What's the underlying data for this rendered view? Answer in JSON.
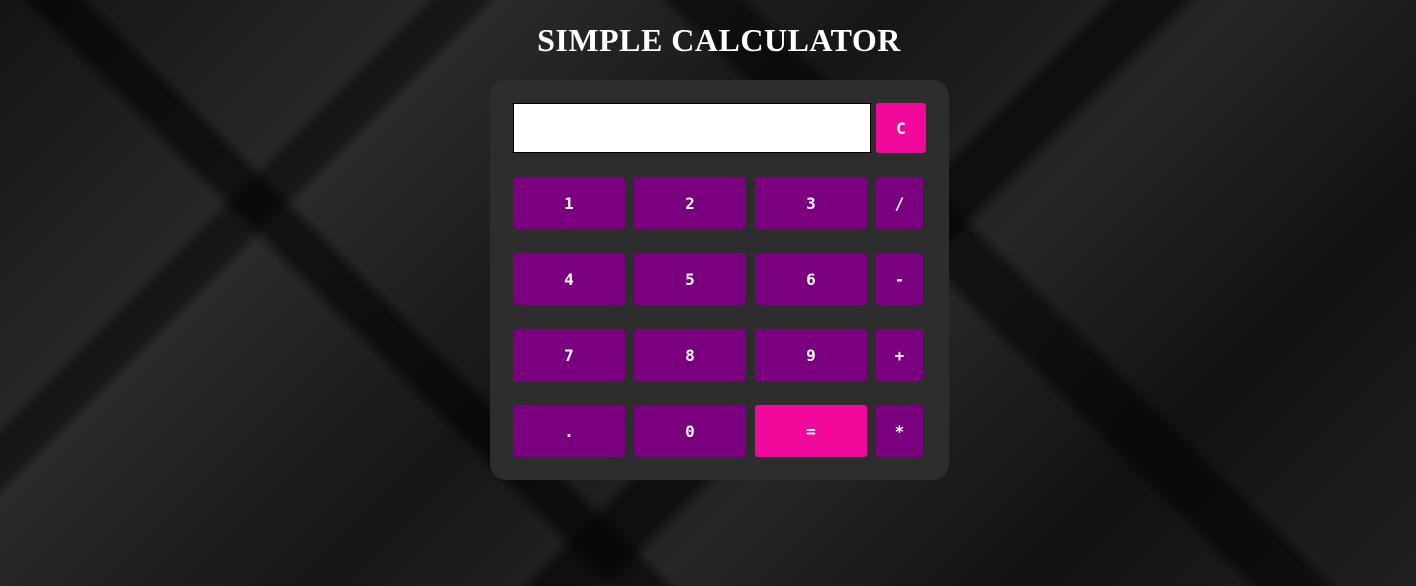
{
  "page": {
    "title": "SIMPLE CALCULATOR"
  },
  "display": {
    "value": ""
  },
  "buttons": {
    "clear": "C",
    "one": "1",
    "two": "2",
    "three": "3",
    "divide": "/",
    "four": "4",
    "five": "5",
    "six": "6",
    "subtract": "-",
    "seven": "7",
    "eight": "8",
    "nine": "9",
    "add": "+",
    "decimal": ".",
    "zero": "0",
    "equals": "=",
    "multiply": "*"
  },
  "colors": {
    "panel": "#2d2d2d",
    "key": "#7a0080",
    "accent": "#f0099a",
    "title": "#ffffff"
  }
}
